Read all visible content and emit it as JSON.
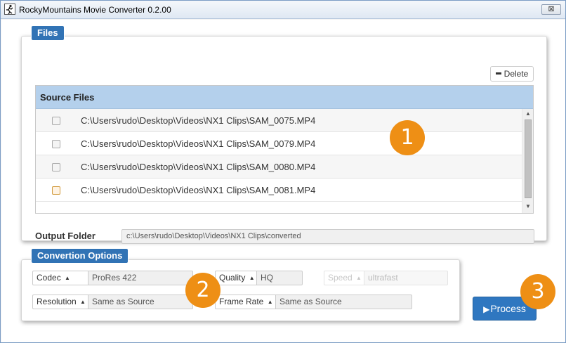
{
  "window": {
    "title": "RockyMountains Movie Converter 0.2.00",
    "close_glyph": "⊠"
  },
  "files": {
    "tag": "Files",
    "delete_label": "Delete",
    "table_header": "Source Files",
    "rows": [
      {
        "path": "C:\\Users\\rudo\\Desktop\\Videos\\NX1 Clips\\SAM_0075.MP4",
        "checked": false
      },
      {
        "path": "C:\\Users\\rudo\\Desktop\\Videos\\NX1 Clips\\SAM_0079.MP4",
        "checked": false
      },
      {
        "path": "C:\\Users\\rudo\\Desktop\\Videos\\NX1 Clips\\SAM_0080.MP4",
        "checked": false
      },
      {
        "path": "C:\\Users\\rudo\\Desktop\\Videos\\NX1 Clips\\SAM_0081.MP4",
        "checked": false
      }
    ],
    "output_label": "Output Folder",
    "output_value": "c:\\Users\\rudo\\Desktop\\Videos\\NX1 Clips\\converted"
  },
  "options": {
    "tag": "Convertion Options",
    "codec_label": "Codec",
    "codec_value": "ProRes 422",
    "quality_label": "Quality",
    "quality_value": "HQ",
    "speed_label": "Speed",
    "speed_value": "ultrafast",
    "resolution_label": "Resolution",
    "resolution_value": "Same as Source",
    "framerate_label": "Frame Rate",
    "framerate_value": "Same as Source"
  },
  "process_label": "Process",
  "badges": [
    "1",
    "2",
    "3"
  ],
  "colors": {
    "accent": "#3173b5",
    "badge": "#ee8f15",
    "table_header": "#b4d0ec"
  }
}
